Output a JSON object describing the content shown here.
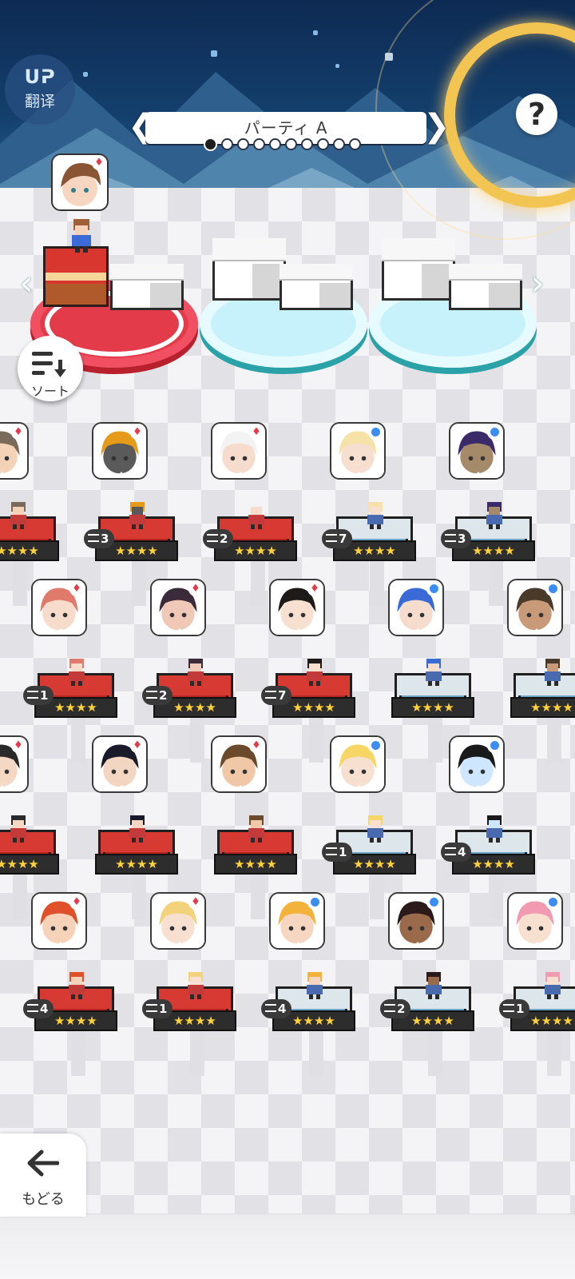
{
  "translate": {
    "glyph": "ᑌᕈ",
    "label": "翻译"
  },
  "party": {
    "name": "パーティ A",
    "prev_label": "❮",
    "next_label": "❯",
    "page_count": 10,
    "current_page": 1
  },
  "help": {
    "label": "?"
  },
  "sort": {
    "label": "ソート",
    "icon": "sort-icon"
  },
  "back": {
    "label": "もどる",
    "icon": "back-arrow-icon"
  },
  "slot_nav": {
    "left": "‹",
    "right": "›"
  },
  "colors": {
    "red_element": "#e33b4a",
    "blue_element": "#3b8df2",
    "star": "#ffd23a",
    "moon": "#f2c452"
  },
  "party_slots": [
    {
      "state": "filled",
      "element": "red"
    },
    {
      "state": "empty"
    },
    {
      "state": "empty"
    }
  ],
  "roster": [
    {
      "element": "red",
      "stars": "★★★★",
      "level": "",
      "hair": "#7a6a5a",
      "skin": "#f4d2b8"
    },
    {
      "element": "red",
      "stars": "★★★★",
      "level": "3",
      "hair": "#e59a1a",
      "skin": "#5a5a5a"
    },
    {
      "element": "red",
      "stars": "★★★★",
      "level": "2",
      "hair": "#f3f3f3",
      "skin": "#f6dccc"
    },
    {
      "element": "blue",
      "stars": "★★★★",
      "level": "7",
      "hair": "#f6e2a6",
      "skin": "#f7dfcf"
    },
    {
      "element": "blue",
      "stars": "★★★★",
      "level": "3",
      "hair": "#3a2a6a",
      "skin": "#a58a6a"
    },
    {
      "element": "red",
      "stars": "★★★★",
      "level": "1",
      "hair": "#e07a6a",
      "skin": "#f7dccc"
    },
    {
      "element": "red",
      "stars": "★★★★",
      "level": "2",
      "hair": "#3a2a3a",
      "skin": "#f0c8b8"
    },
    {
      "element": "red",
      "stars": "★★★★",
      "level": "7",
      "hair": "#1f1a1a",
      "skin": "#f7e0d0"
    },
    {
      "element": "blue",
      "stars": "★★★★",
      "level": "",
      "hair": "#3a6ad6",
      "skin": "#f6dccc"
    },
    {
      "element": "blue",
      "stars": "★★★★",
      "level": "",
      "hair": "#4a3a2a",
      "skin": "#c89a78"
    },
    {
      "element": "red",
      "stars": "★★★★",
      "level": "",
      "hair": "#2a2a2a",
      "skin": "#f4d8c4"
    },
    {
      "element": "red",
      "stars": "★★★★",
      "level": "",
      "hair": "#1a1a2a",
      "skin": "#f3d6c2"
    },
    {
      "element": "red",
      "stars": "★★★★",
      "level": "",
      "hair": "#6a4a2a",
      "skin": "#f0c8a8"
    },
    {
      "element": "blue",
      "stars": "★★★★",
      "level": "1",
      "hair": "#f6d766",
      "skin": "#f7e0d0"
    },
    {
      "element": "blue",
      "stars": "★★★★",
      "level": "4",
      "hair": "#1a1a1a",
      "skin": "#cfe6ff"
    },
    {
      "element": "red",
      "stars": "★★★★",
      "level": "4",
      "hair": "#e0502a",
      "skin": "#f6d2b8"
    },
    {
      "element": "red",
      "stars": "★★★★",
      "level": "1",
      "hair": "#f2d27a",
      "skin": "#f7e0d0"
    },
    {
      "element": "blue",
      "stars": "★★★★",
      "level": "4",
      "hair": "#f3b23a",
      "skin": "#f6d6c0"
    },
    {
      "element": "blue",
      "stars": "★★★★",
      "level": "2",
      "hair": "#2a1a1a",
      "skin": "#9a6a4a"
    },
    {
      "element": "blue",
      "stars": "★★★★",
      "level": "1",
      "hair": "#f29ab2",
      "skin": "#f7e0d0"
    }
  ]
}
